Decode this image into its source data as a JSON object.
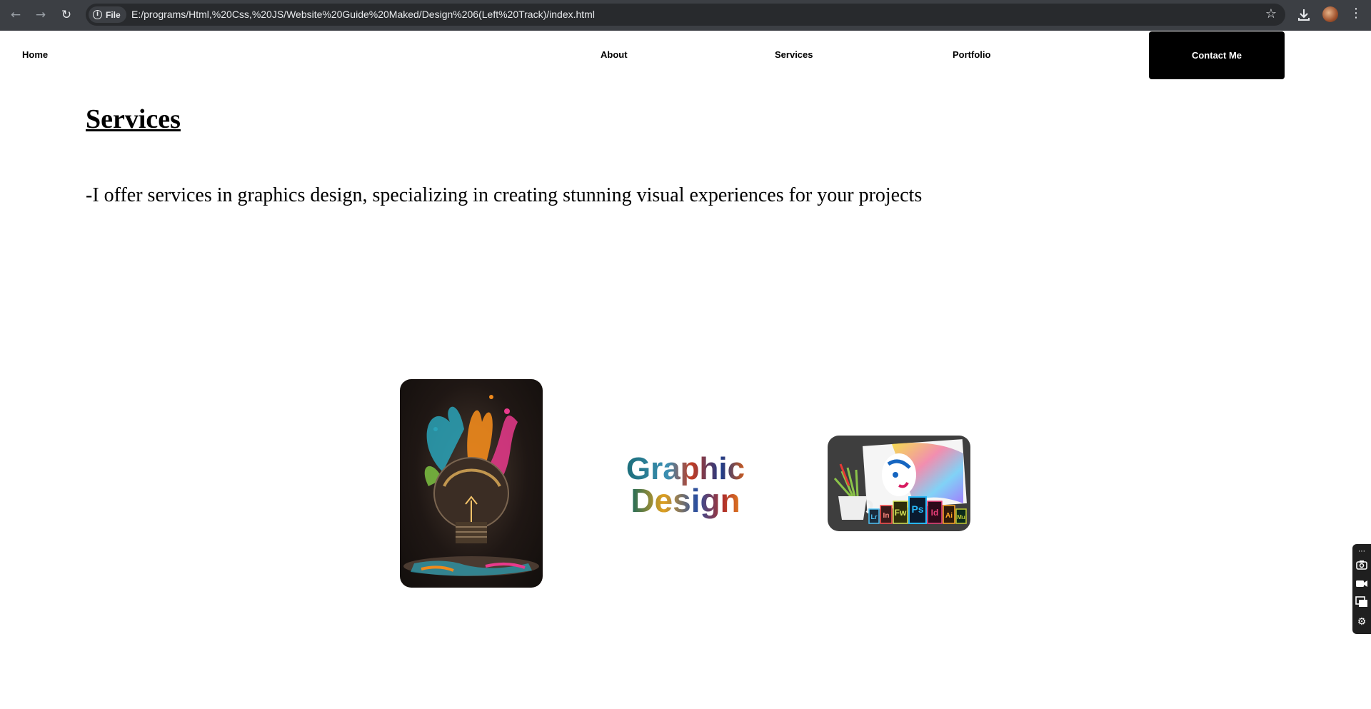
{
  "browser": {
    "back_icon": "arrow-left-icon",
    "forward_icon": "arrow-right-icon",
    "reload_icon": "reload-icon",
    "site_chip_label": "File",
    "url": "E:/programs/Html,%20Css,%20JS/Website%20Guide%20Maked/Design%206(Left%20Track)/index.html",
    "colors": {
      "chrome": "#3c3f44",
      "omnibox": "#282a2d",
      "text": "#e8eaed"
    }
  },
  "nav": {
    "home": "Home",
    "about": "About",
    "services": "Services",
    "portfolio": "Portfolio",
    "contact": "Contact Me",
    "colors": {
      "contact_bg": "#000000",
      "contact_text": "#ffffff"
    }
  },
  "main": {
    "title": "Services",
    "description": "-I offer services in graphics design, specializing in creating stunning visual experiences for your projects"
  },
  "images": {
    "graphic_design": {
      "line1": "Graphic",
      "line2": "Design"
    },
    "tools": [
      "Lr",
      "In",
      "Fw",
      "Ps",
      "Id",
      "Ai",
      "Mu"
    ]
  }
}
